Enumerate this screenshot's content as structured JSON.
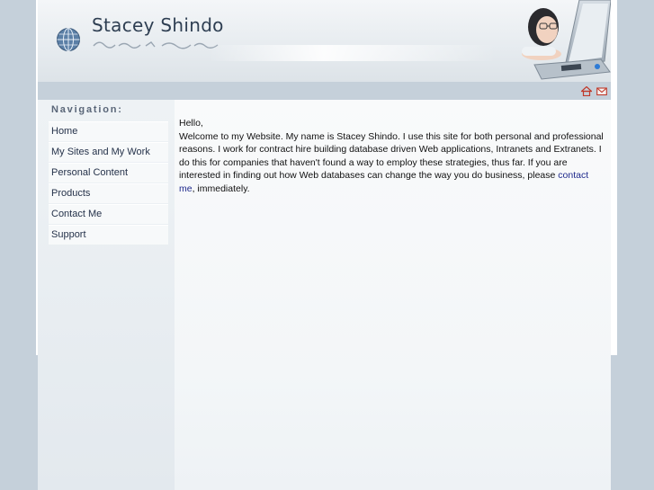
{
  "header": {
    "title": "Stacey Shindo"
  },
  "toolbar": {
    "home_icon": "home-icon",
    "mail_icon": "mail-icon"
  },
  "nav": {
    "heading": "Navigation:",
    "items": [
      {
        "label": "Home"
      },
      {
        "label": "My Sites and My Work"
      },
      {
        "label": "Personal Content"
      },
      {
        "label": "Products"
      },
      {
        "label": "Contact Me"
      },
      {
        "label": "Support"
      }
    ]
  },
  "content": {
    "greeting": "Hello,",
    "body_before_link": "Welcome to my Website.  My name is Stacey Shindo.  I use this site for both personal and professional reasons.  I work for contract hire building database driven Web applications, Intranets and Extranets.  I do this for companies that haven't found a way to employ these strategies, thus far.  If you are interested in finding out how Web databases can change the way you do business, please ",
    "link_text": "contact me",
    "body_after_link": ", immediately."
  },
  "colors": {
    "frame": "#c5d0da",
    "link": "#1f2a8c",
    "title": "#2e3e52"
  }
}
